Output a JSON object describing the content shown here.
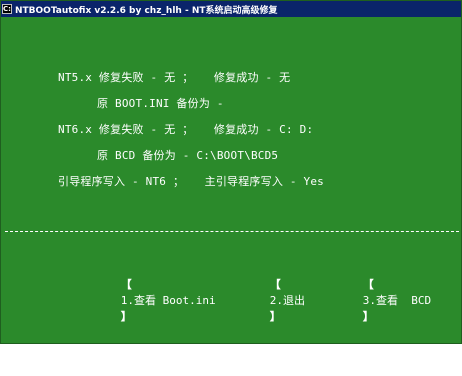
{
  "window": {
    "title": "NTBOOTautofix v2.2.6 by chz_hlh - NT系统启动高级修复",
    "icon_name": "console-icon"
  },
  "console": {
    "nt5_line": "NT5.x 修复失败 - 无 ；   修复成功 - 无",
    "nt5_backup": "原 BOOT.INI 备份为 -",
    "nt6_line": "NT6.x 修复失败 - 无 ；   修复成功 - C: D:",
    "nt6_backup": "原 BCD 备份为 - C:\\BOOT\\BCD5",
    "boot_write": "引导程序写入 - NT6 ；   主引导程序写入 - Yes",
    "divider": "--------------------------------------------------------------------------"
  },
  "menu": {
    "items": [
      {
        "left": "【",
        "label": "1.查看 Boot.ini",
        "right": "】"
      },
      {
        "left": "【",
        "label": "2.退出",
        "right": "】"
      },
      {
        "left": "【",
        "label": "3.查看  BCD",
        "right": "】"
      }
    ]
  },
  "colors": {
    "background": "#2b8a2b",
    "text": "#ffffff",
    "titlebar": "#0a246a"
  }
}
